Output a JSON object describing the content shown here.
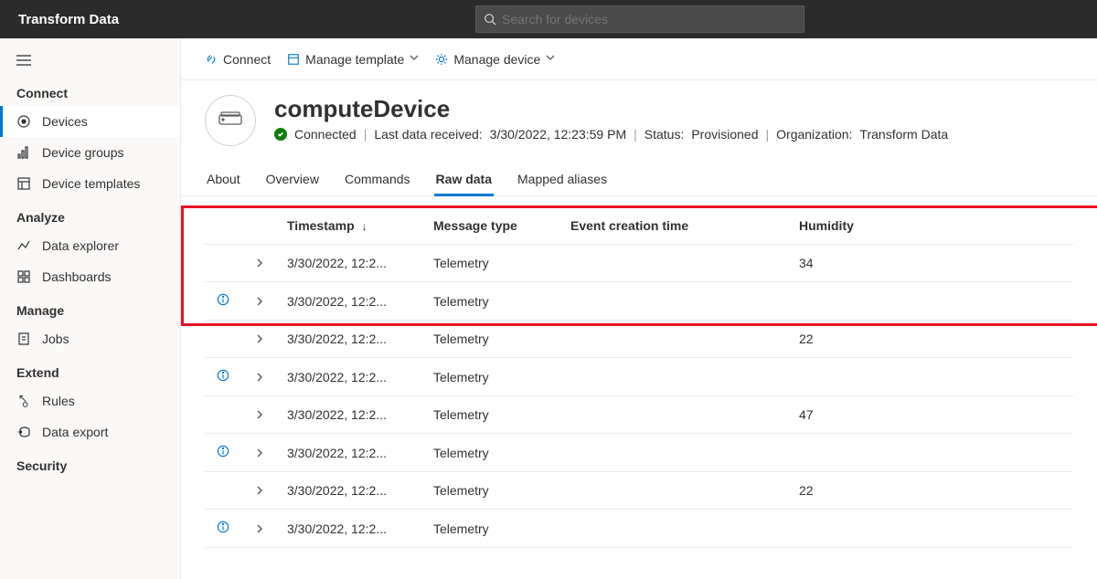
{
  "topbar": {
    "title": "Transform Data",
    "search_placeholder": "Search for devices"
  },
  "sidebar": {
    "sections": [
      {
        "title": "Connect",
        "items": [
          {
            "label": "Devices",
            "icon": "devices",
            "active": true
          },
          {
            "label": "Device groups",
            "icon": "groups"
          },
          {
            "label": "Device templates",
            "icon": "templates"
          }
        ]
      },
      {
        "title": "Analyze",
        "items": [
          {
            "label": "Data explorer",
            "icon": "explorer"
          },
          {
            "label": "Dashboards",
            "icon": "dashboards"
          }
        ]
      },
      {
        "title": "Manage",
        "items": [
          {
            "label": "Jobs",
            "icon": "jobs"
          }
        ]
      },
      {
        "title": "Extend",
        "items": [
          {
            "label": "Rules",
            "icon": "rules"
          },
          {
            "label": "Data export",
            "icon": "export"
          }
        ]
      },
      {
        "title": "Security",
        "items": []
      }
    ]
  },
  "actions": {
    "connect": "Connect",
    "manage_template": "Manage template",
    "manage_device": "Manage device"
  },
  "device": {
    "name": "computeDevice",
    "connected_label": "Connected",
    "last_data_label": "Last data received:",
    "last_data_value": "3/30/2022, 12:23:59 PM",
    "status_label": "Status:",
    "status_value": "Provisioned",
    "org_label": "Organization:",
    "org_value": "Transform Data"
  },
  "tabs": [
    {
      "label": "About"
    },
    {
      "label": "Overview"
    },
    {
      "label": "Commands"
    },
    {
      "label": "Raw data",
      "active": true
    },
    {
      "label": "Mapped aliases"
    }
  ],
  "table": {
    "headers": {
      "timestamp": "Timestamp",
      "message_type": "Message type",
      "event_creation": "Event creation time",
      "humidity": "Humidity"
    },
    "rows": [
      {
        "ts": "3/30/2022, 12:2...",
        "mt": "Telemetry",
        "hum": "34",
        "info": false
      },
      {
        "ts": "3/30/2022, 12:2...",
        "mt": "Telemetry",
        "hum": "",
        "info": true
      },
      {
        "ts": "3/30/2022, 12:2...",
        "mt": "Telemetry",
        "hum": "22",
        "info": false
      },
      {
        "ts": "3/30/2022, 12:2...",
        "mt": "Telemetry",
        "hum": "",
        "info": true
      },
      {
        "ts": "3/30/2022, 12:2...",
        "mt": "Telemetry",
        "hum": "47",
        "info": false
      },
      {
        "ts": "3/30/2022, 12:2...",
        "mt": "Telemetry",
        "hum": "",
        "info": true
      },
      {
        "ts": "3/30/2022, 12:2...",
        "mt": "Telemetry",
        "hum": "22",
        "info": false
      },
      {
        "ts": "3/30/2022, 12:2...",
        "mt": "Telemetry",
        "hum": "",
        "info": true
      }
    ]
  }
}
